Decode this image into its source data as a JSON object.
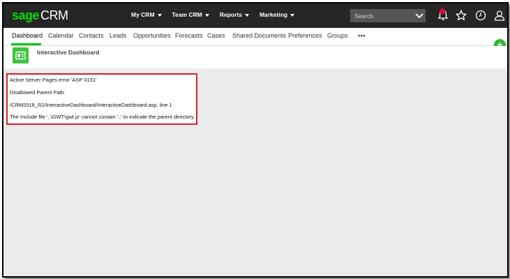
{
  "brand": {
    "sage": "sage",
    "crm": "CRM"
  },
  "top_menu": [
    {
      "label": "My CRM"
    },
    {
      "label": "Team CRM"
    },
    {
      "label": "Reports"
    },
    {
      "label": "Marketing"
    }
  ],
  "search": {
    "placeholder": "Search"
  },
  "icons": {
    "notifications": "bell-icon",
    "favorites": "star-icon",
    "recent": "clock-icon",
    "user": "user-icon",
    "add": "plus-icon",
    "dashboard": "dashboard-icon"
  },
  "tabs": [
    {
      "label": "Dashboard",
      "active": true
    },
    {
      "label": "Calendar"
    },
    {
      "label": "Contacts"
    },
    {
      "label": "Leads"
    },
    {
      "label": "Opportunities"
    },
    {
      "label": "Forecasts"
    },
    {
      "label": "Cases"
    },
    {
      "label": "Shared Documents"
    },
    {
      "label": "Preferences"
    },
    {
      "label": "Groups"
    }
  ],
  "more_label": "•••",
  "add_label": "+",
  "page": {
    "title": "Interactive Dashboard"
  },
  "error": {
    "line1": "Active Server Pages error 'ASP 0131'",
    "line2": "Disallowed Parent Path",
    "line3": "/CRM2018_R2/InteractiveDashboard/InteractiveDashboard.asp, line 1",
    "line4": "The Include file '..\\GWT\\gwt.js' cannot contain '..' to indicate the parent directory."
  },
  "colors": {
    "topbar": "#262626",
    "brand_green": "#00dc00",
    "active_tab_underline": "#00c400",
    "add_button": "#2eb82e",
    "error_border": "#d8212a",
    "notification_badge": "#e8003d"
  }
}
